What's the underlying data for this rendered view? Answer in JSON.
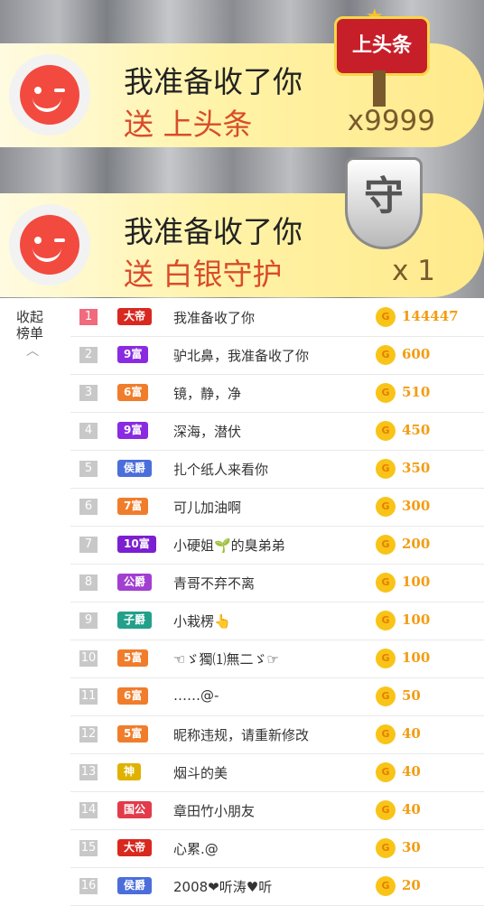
{
  "banners": [
    {
      "name": "我准备收了你",
      "gift": "送 上头条",
      "count": "x9999",
      "badge": "上头条"
    },
    {
      "name": "我准备收了你",
      "gift": "送 白银守护",
      "count": "x 1",
      "badge": "守"
    }
  ],
  "collapse_label": "收起榜单",
  "collapse_arrow": "︿",
  "coin_glyph": "G",
  "rows": [
    {
      "rank": "1",
      "badge": "大帝",
      "badge_color": "#d8281f",
      "name": "我准备收了你",
      "amount": "144447"
    },
    {
      "rank": "2",
      "badge": "9富",
      "badge_color": "#8a2be2",
      "name": "驴北鼻，我准备收了你",
      "amount": "600"
    },
    {
      "rank": "3",
      "badge": "6富",
      "badge_color": "#f07d2b",
      "name": "镜，静，净",
      "amount": "510"
    },
    {
      "rank": "4",
      "badge": "9富",
      "badge_color": "#8a2be2",
      "name": "深海，潜伏",
      "amount": "450"
    },
    {
      "rank": "5",
      "badge": "侯爵",
      "badge_color": "#4b6edb",
      "name": "扎个纸人来看你",
      "amount": "350"
    },
    {
      "rank": "6",
      "badge": "7富",
      "badge_color": "#f07d2b",
      "name": "可儿加油啊",
      "amount": "300"
    },
    {
      "rank": "7",
      "badge": "10富",
      "badge_color": "#7b1fd1",
      "name": "小硬姐🌱的臭弟弟",
      "amount": "200"
    },
    {
      "rank": "8",
      "badge": "公爵",
      "badge_color": "#a23fd0",
      "name": "青哥不弃不离",
      "amount": "100"
    },
    {
      "rank": "9",
      "badge": "子爵",
      "badge_color": "#23a08a",
      "name": "小栽楞👆",
      "amount": "100"
    },
    {
      "rank": "10",
      "badge": "5富",
      "badge_color": "#f07d2b",
      "name": "☜ゞ獨⑴無二ゞ☞",
      "amount": "100"
    },
    {
      "rank": "11",
      "badge": "6富",
      "badge_color": "#f07d2b",
      "name": "……@-",
      "amount": "50"
    },
    {
      "rank": "12",
      "badge": "5富",
      "badge_color": "#f07d2b",
      "name": "昵称违规，请重新修改",
      "amount": "40"
    },
    {
      "rank": "13",
      "badge": "神",
      "badge_color": "#e0b200",
      "name": "烟斗的美",
      "amount": "40"
    },
    {
      "rank": "14",
      "badge": "国公",
      "badge_color": "#e23b4a",
      "name": "章田竹小朋友",
      "amount": "40"
    },
    {
      "rank": "15",
      "badge": "大帝",
      "badge_color": "#d8281f",
      "name": "心累.@",
      "amount": "30"
    },
    {
      "rank": "16",
      "badge": "侯爵",
      "badge_color": "#4b6edb",
      "name": "2008❤听涛♥听",
      "amount": "20"
    }
  ]
}
